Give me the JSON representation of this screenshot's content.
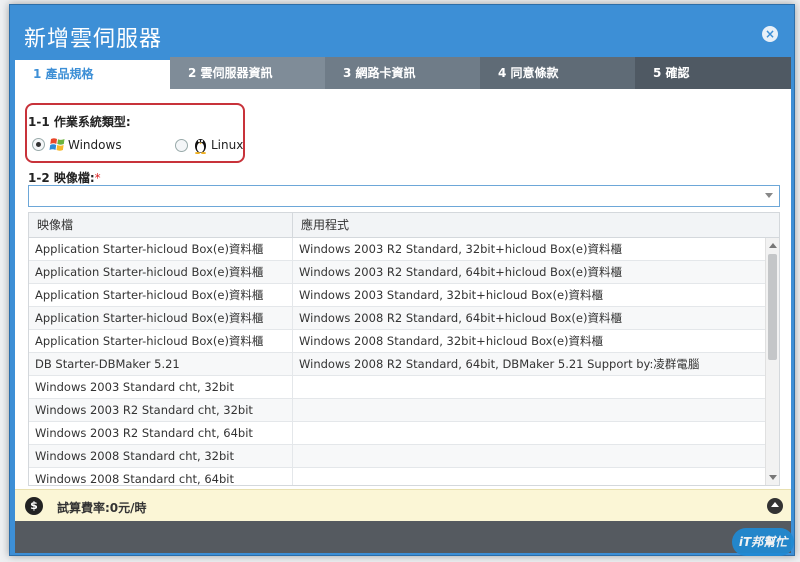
{
  "dialog": {
    "title": "新增雲伺服器",
    "close_label": "×"
  },
  "tabs": [
    {
      "label": "1 產品規格",
      "active": true
    },
    {
      "label": "2 雲伺服器資訊",
      "active": false
    },
    {
      "label": "3 網路卡資訊",
      "active": false
    },
    {
      "label": "4 同意條款",
      "active": false
    },
    {
      "label": "5 確認",
      "active": false
    }
  ],
  "os_section": {
    "label": "1-1 作業系統類型:",
    "options": [
      {
        "label": "Windows",
        "selected": true,
        "icon": "windows-icon"
      },
      {
        "label": "Linux",
        "selected": false,
        "icon": "tux-icon"
      }
    ]
  },
  "image_section": {
    "label": "1-2 映像檔:",
    "required_mark": "*",
    "selected_value": ""
  },
  "grid": {
    "columns": [
      "映像檔",
      "應用程式"
    ],
    "rows": [
      [
        "Application Starter-hicloud Box(e)資料櫃",
        "Windows 2003 R2 Standard, 32bit+hicloud Box(e)資料櫃"
      ],
      [
        "Application Starter-hicloud Box(e)資料櫃",
        "Windows 2003 R2 Standard, 64bit+hicloud Box(e)資料櫃"
      ],
      [
        "Application Starter-hicloud Box(e)資料櫃",
        "Windows 2003 Standard, 32bit+hicloud Box(e)資料櫃"
      ],
      [
        "Application Starter-hicloud Box(e)資料櫃",
        "Windows 2008 R2 Standard, 64bit+hicloud Box(e)資料櫃"
      ],
      [
        "Application Starter-hicloud Box(e)資料櫃",
        "Windows 2008 Standard, 32bit+hicloud Box(e)資料櫃"
      ],
      [
        "DB Starter-DBMaker 5.21",
        "Windows 2008 R2 Standard, 64bit, DBMaker 5.21 Support by:凌群電腦"
      ],
      [
        "Windows 2003 Standard cht, 32bit",
        ""
      ],
      [
        "Windows 2003 R2 Standard cht, 32bit",
        ""
      ],
      [
        "Windows 2003 R2 Standard cht, 64bit",
        ""
      ],
      [
        "Windows 2008 Standard cht, 32bit",
        ""
      ],
      [
        "Windows 2008 Standard cht, 64bit",
        ""
      ]
    ]
  },
  "footer": {
    "currency_icon": "$",
    "cost_label": "試算費率:0元/時"
  },
  "watermark": "iT邦幫忙",
  "colors": {
    "accent": "#3d8fd6",
    "highlight_box": "#c8323a",
    "footer_bg": "#fbf6d6"
  }
}
